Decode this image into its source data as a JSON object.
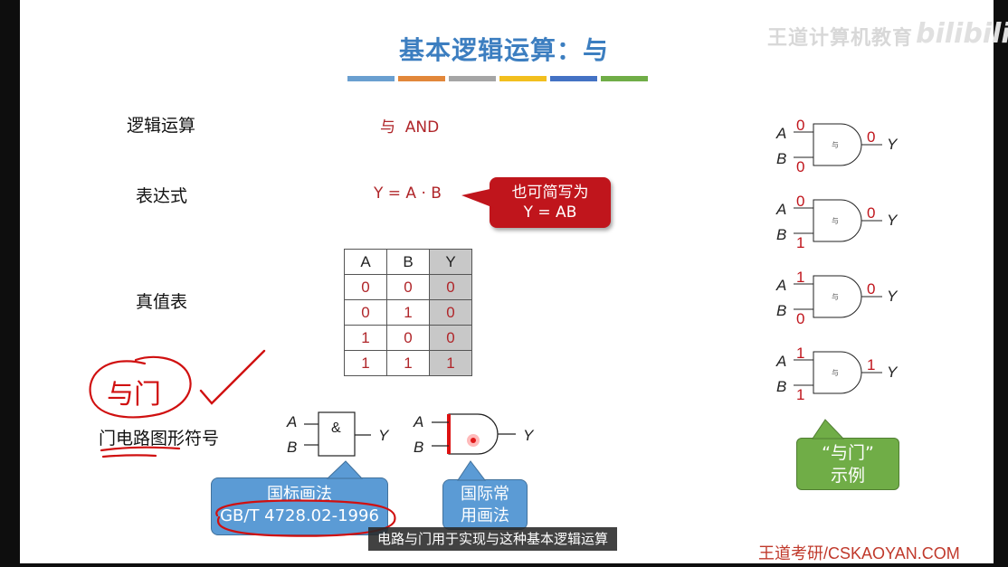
{
  "slide": {
    "title": "基本逻辑运算：与",
    "accent_colors": [
      "#6a9fd0",
      "#e2873a",
      "#a5a5a5",
      "#f2bf1e",
      "#4472c4",
      "#70ad47"
    ],
    "watermark_text": "王道计算机教育",
    "watermark_logo": "bilibili",
    "rows": {
      "operation_label": "逻辑运算",
      "operation_value": "与  AND",
      "expression_label": "表达式",
      "expression_value": "Y = A · B",
      "truth_table_label": "真值表",
      "symbol_label": "门电路图形符号"
    },
    "callouts": {
      "shorthand": [
        "也可简写为",
        "Y = AB"
      ],
      "national_standard": [
        "国标画法",
        "GB/T 4728.02-1996"
      ],
      "international": [
        "国际常",
        "用画法"
      ],
      "examples": [
        "“与门”",
        "示例"
      ]
    },
    "truth_table": {
      "headers": [
        "A",
        "B",
        "Y"
      ],
      "rows": [
        [
          "0",
          "0",
          "0"
        ],
        [
          "0",
          "1",
          "0"
        ],
        [
          "1",
          "0",
          "0"
        ],
        [
          "1",
          "1",
          "1"
        ]
      ]
    },
    "gate_symbols": {
      "input_a": "A",
      "input_b": "B",
      "output": "Y",
      "national_mark": "&"
    },
    "gate_examples": [
      {
        "a": "0",
        "b": "0",
        "y": "0",
        "gate_text": "与"
      },
      {
        "a": "0",
        "b": "1",
        "y": "0",
        "gate_text": "与"
      },
      {
        "a": "1",
        "b": "0",
        "y": "0",
        "gate_text": "与"
      },
      {
        "a": "1",
        "b": "1",
        "y": "1",
        "gate_text": "与"
      }
    ],
    "handwriting": "与门",
    "subtitle": "电路与门用于实现与这种基本逻辑运算",
    "brand": "王道考研/CSKAOYAN.COM"
  }
}
